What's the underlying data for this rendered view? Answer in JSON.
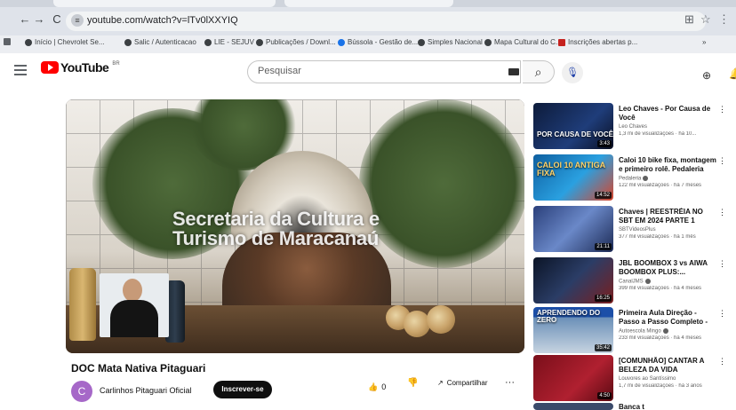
{
  "browser": {
    "url": "youtube.com/watch?v=lTv0lXXYIQ",
    "back_glyph": "←",
    "forward_glyph": "→",
    "reload_glyph": "C",
    "site_info_glyph": "≡",
    "omnibox_right_icons": [
      "translate-icon",
      "star-icon"
    ]
  },
  "bookmarks": [
    {
      "label": "Início | Chevrolet Se...",
      "icon": "chevrolet-icon"
    },
    {
      "label": "Salic / Autenticacao",
      "icon": "salic-icon"
    },
    {
      "label": "LIE - SEJUV",
      "icon": "bookmark-icon"
    },
    {
      "label": "Publicações / Downl...",
      "icon": "bookmark-icon"
    },
    {
      "label": "Bússola - Gestão de...",
      "icon": "compass-icon"
    },
    {
      "label": "Simples Nacional",
      "icon": "simples-icon"
    },
    {
      "label": "Mapa Cultural do C...",
      "icon": "bookmark-icon"
    },
    {
      "label": "Inscrições abertas p...",
      "icon": "red-bookmark-icon"
    }
  ],
  "youtube": {
    "logo_text": "YouTube",
    "country_code": "BR",
    "search_placeholder": "Pesquisar",
    "search_glyph": "⌕",
    "mic_glyph": "🎙"
  },
  "video": {
    "overlay_text": "Secretaria da Cultura e Turismo de Maracanaú",
    "title": "DOC Mata Nativa Pitaguari",
    "channel_initial": "C",
    "channel_name": "Carlinhos Pitaguari Oficial",
    "subscribe_label": "Inscrever-se",
    "like_count": "0",
    "like_glyph": "👍",
    "dislike_glyph": "👎",
    "share_glyph": "↗",
    "share_label": "Compartilhar",
    "more_glyph": "···"
  },
  "recommendations": [
    {
      "title": "Leo Chaves - Por Causa de Você",
      "channel": "Leo Chaves",
      "meta": "1,3 mi de visualizações · há 10...",
      "duration": "3:43",
      "caption": "POR CAUSA DE VOCÊ",
      "verified": false
    },
    {
      "title": "Caloi 10 bike fixa, montagem e primeiro rolê. Pedaleria",
      "channel": "Pedaleria",
      "meta": "122 mil visualizações · há 7 meses",
      "duration": "14:52",
      "caption": "CALOI 10 ANTIGA FIXA",
      "verified": true
    },
    {
      "title": "Chaves | REESTRÉIA NO SBT EM 2024 PARTE 1 (12/10/24)",
      "channel": "SBTVideosPlus",
      "meta": "377 mil visualizações · há 1 mês",
      "duration": "21:11",
      "caption": "",
      "verified": false
    },
    {
      "title": "JBL BOOMBOX 3 vs AIWA BOOMBOX PLUS:...",
      "channel": "CanalJMS",
      "meta": "399 mil visualizações · há 4 meses",
      "duration": "16:25",
      "caption": "",
      "verified": true
    },
    {
      "title": "Primeira Aula Direção - Passo a Passo Completo - Rumo a...",
      "channel": "Autoescola Mingo",
      "meta": "233 mil visualizações · há 4 meses",
      "duration": "35:42",
      "caption": "APRENDENDO DO ZERO",
      "verified": true
    },
    {
      "title": "[COMUNHÃO] CANTAR A BELEZA DA VIDA",
      "channel": "Louvores ao Santíssimo",
      "meta": "1,7 mi de visualizações · há 3 anos",
      "duration": "4:50",
      "caption": "",
      "verified": false
    }
  ],
  "partial_next_title": "Banca t"
}
